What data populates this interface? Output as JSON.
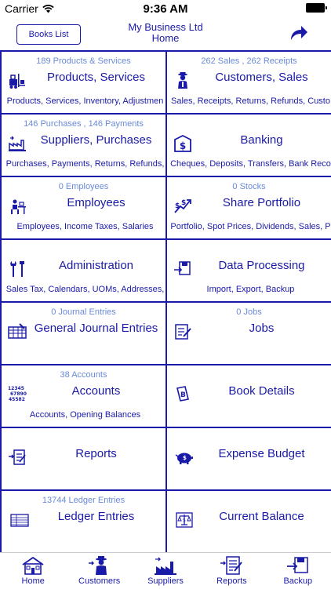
{
  "status": {
    "carrier": "Carrier",
    "time": "9:36 AM"
  },
  "nav": {
    "books_label": "Books List",
    "title": "My Business Ltd",
    "subtitle": "Home"
  },
  "cells": [
    {
      "count": "189 Products & Services",
      "title": "Products, Services",
      "sub": "Products, Services, Inventory, Adjustmen",
      "icon": "forklift-icon"
    },
    {
      "count": "262 Sales , 262 Receipts",
      "title": "Customers, Sales",
      "sub": "Sales, Receipts, Returns, Refunds, Custo",
      "icon": "customer-icon"
    },
    {
      "count": "146 Purchases , 146 Payments",
      "title": "Suppliers, Purchases",
      "sub": "Purchases, Payments, Returns, Refunds,",
      "icon": "factory-icon"
    },
    {
      "count": "",
      "title": "Banking",
      "sub": "Cheques, Deposits, Transfers, Bank Reco",
      "icon": "bank-icon"
    },
    {
      "count": "0 Employees",
      "title": "Employees",
      "sub": "Employees, Income Taxes, Salaries",
      "icon": "employee-desk-icon"
    },
    {
      "count": "0 Stocks",
      "title": "Share Portfolio",
      "sub": "Portfolio, Spot Prices, Dividends, Sales, P",
      "icon": "stocks-icon"
    },
    {
      "count": "",
      "title": "Administration",
      "sub": "Sales Tax, Calendars, UOMs, Addresses,",
      "icon": "tools-icon"
    },
    {
      "count": "",
      "title": "Data Processing",
      "sub": "Import, Export, Backup",
      "icon": "import-export-icon"
    },
    {
      "count": "0 Journal Entries",
      "title": "General Journal Entries",
      "sub": "",
      "icon": "journal-icon"
    },
    {
      "count": "0 Jobs",
      "title": "Jobs",
      "sub": "",
      "icon": "jobs-icon"
    },
    {
      "count": "38 Accounts",
      "title": "Accounts",
      "sub": "Accounts, Opening Balances",
      "icon": "accounts-numbers-icon"
    },
    {
      "count": "",
      "title": "Book Details",
      "sub": "",
      "icon": "book-icon"
    },
    {
      "count": "",
      "title": "Reports",
      "sub": "",
      "icon": "reports-icon"
    },
    {
      "count": "",
      "title": "Expense Budget",
      "sub": "",
      "icon": "piggy-bank-icon"
    },
    {
      "count": "13744 Ledger Entries",
      "title": "Ledger Entries",
      "sub": "",
      "icon": "ledger-icon"
    },
    {
      "count": "",
      "title": "Current Balance",
      "sub": "",
      "icon": "balance-scale-icon"
    }
  ],
  "accounts_icon_numbers": [
    "12345",
    "67890",
    "45582"
  ],
  "tabs": [
    {
      "label": "Home",
      "icon": "house-icon"
    },
    {
      "label": "Customers",
      "icon": "customer-icon"
    },
    {
      "label": "Suppliers",
      "icon": "factory-icon"
    },
    {
      "label": "Reports",
      "icon": "reports-icon"
    },
    {
      "label": "Backup",
      "icon": "backup-icon"
    }
  ],
  "colors": {
    "accent": "#1a1aa8",
    "count_text": "#6a8ad8"
  }
}
